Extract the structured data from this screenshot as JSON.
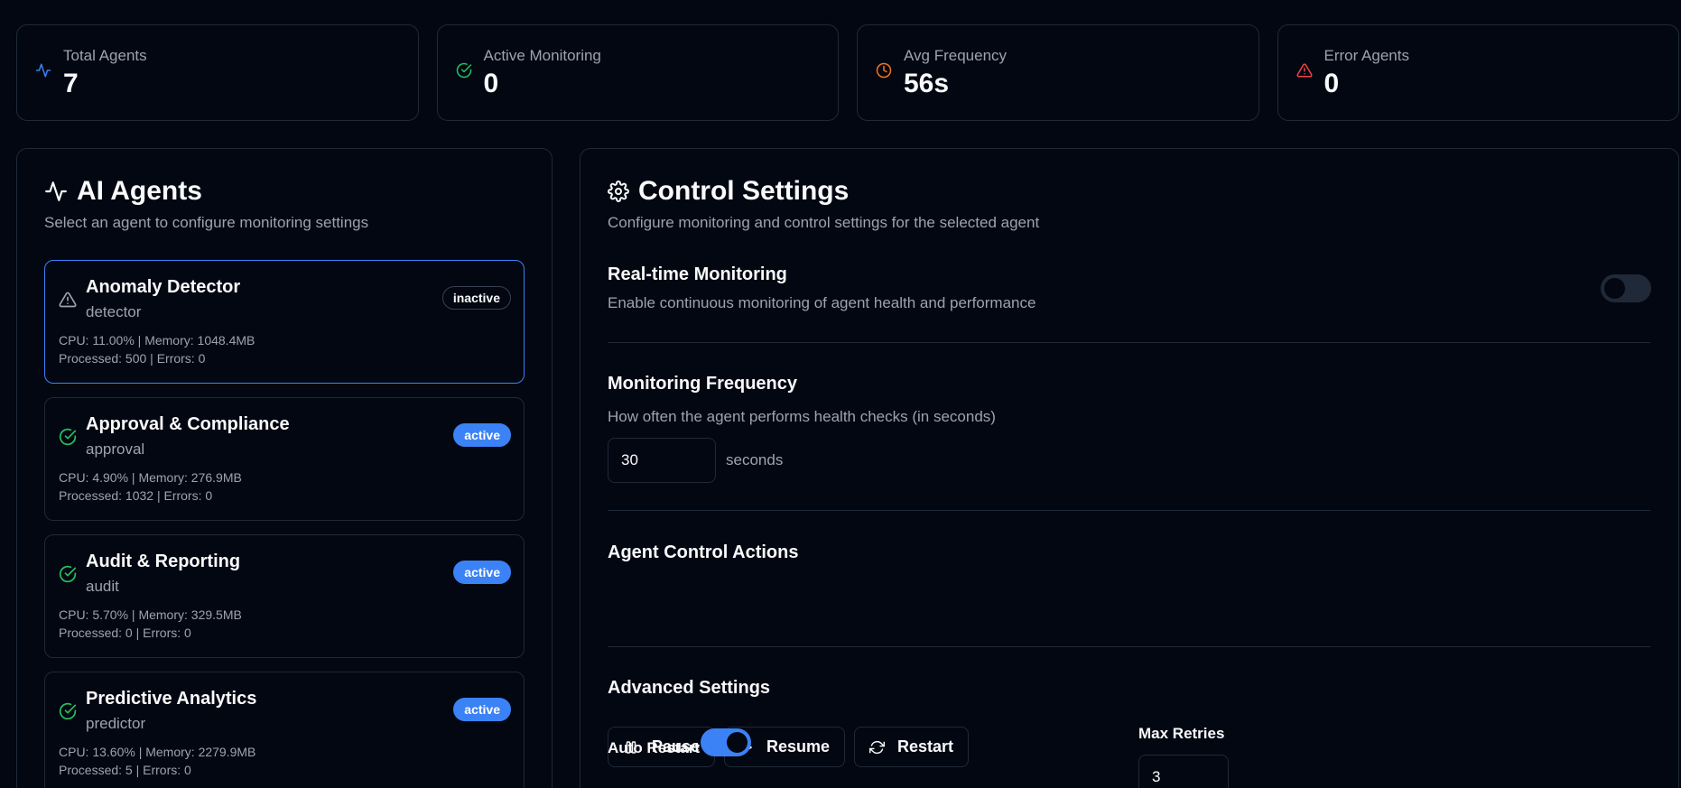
{
  "stats": [
    {
      "label": "Total Agents",
      "value": "7",
      "icon": "activity-icon",
      "color": "#3b82f6"
    },
    {
      "label": "Active Monitoring",
      "value": "0",
      "icon": "check-circle-icon",
      "color": "#22c55e"
    },
    {
      "label": "Avg Frequency",
      "value": "56s",
      "icon": "clock-icon",
      "color": "#f97316"
    },
    {
      "label": "Error Agents",
      "value": "0",
      "icon": "alert-triangle-icon",
      "color": "#ef4444"
    }
  ],
  "agents_panel": {
    "title": "AI Agents",
    "description": "Select an agent to configure monitoring settings",
    "agents": [
      {
        "name": "Anomaly Detector",
        "type": "detector",
        "status": "inactive",
        "metrics1": "CPU: 11.00% | Memory: 1048.4MB",
        "metrics2": "Processed: 500 | Errors: 0",
        "icon": "alert-triangle-icon"
      },
      {
        "name": "Approval & Compliance",
        "type": "approval",
        "status": "active",
        "metrics1": "CPU: 4.90% | Memory: 276.9MB",
        "metrics2": "Processed: 1032 | Errors: 0",
        "icon": "check-circle-icon"
      },
      {
        "name": "Audit & Reporting",
        "type": "audit",
        "status": "active",
        "metrics1": "CPU: 5.70% | Memory: 329.5MB",
        "metrics2": "Processed: 0 | Errors: 0",
        "icon": "check-circle-icon"
      },
      {
        "name": "Predictive Analytics",
        "type": "predictor",
        "status": "active",
        "metrics1": "CPU: 13.60% | Memory: 2279.9MB",
        "metrics2": "Processed: 5 | Errors: 0",
        "icon": "check-circle-icon"
      }
    ]
  },
  "control_panel": {
    "title": "Control Settings",
    "description": "Configure monitoring and control settings for the selected agent",
    "realtime": {
      "title": "Real-time Monitoring",
      "description": "Enable continuous monitoring of agent health and performance",
      "enabled": false
    },
    "frequency": {
      "title": "Monitoring Frequency",
      "description": "How often the agent performs health checks (in seconds)",
      "value": "30",
      "unit": "seconds"
    },
    "actions": {
      "title": "Agent Control Actions",
      "pause": "Pause",
      "resume": "Resume",
      "restart": "Restart"
    },
    "advanced": {
      "title": "Advanced Settings",
      "auto_restart_label": "Auto Restart",
      "auto_restart": true,
      "max_retries_label": "Max Retries",
      "max_retries": "3"
    }
  }
}
